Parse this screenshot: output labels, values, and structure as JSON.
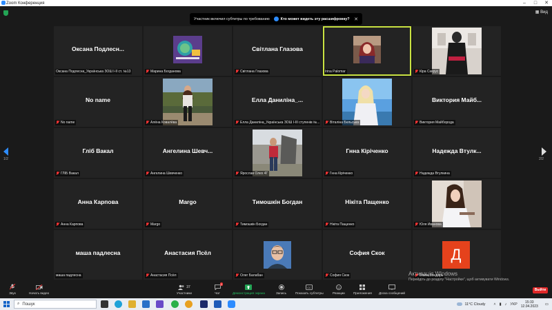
{
  "window": {
    "title": "Zoom Конференция"
  },
  "view_label": "Вид",
  "banner": {
    "text": "Участник включил субтитры по требованию",
    "link": "Кто может видеть эту расшифровку?"
  },
  "nav": {
    "left_page": "1/2",
    "right_page": "2/2"
  },
  "tiles": [
    {
      "big_name": "Оксана Подлесн...",
      "label": "Оксана Подлесна_Українська ЗОШ І-ІІ ст. №13",
      "muted": false
    },
    {
      "big_name": "",
      "label": "Марина Богданова",
      "muted": true
    },
    {
      "big_name": "Світлана Глазова",
      "label": "Світлана Глазова",
      "muted": true
    },
    {
      "big_name": "",
      "label": "Irina Palomar",
      "muted": false
    },
    {
      "big_name": "",
      "label": "Кіра Скерус",
      "muted": true
    },
    {
      "big_name": "No name",
      "label": "No name",
      "muted": true
    },
    {
      "big_name": "",
      "label": "Алёна Ковалёва",
      "muted": true
    },
    {
      "big_name": "Елла Даниліна_...",
      "label": "Елла Даниліна_Українська ЗОШ І-ІІІ ступенів №...",
      "muted": true
    },
    {
      "big_name": "",
      "label": "Віталіна Бельська",
      "muted": true
    },
    {
      "big_name": "Виктория Майб...",
      "label": "Виктория Майборода",
      "muted": true
    },
    {
      "big_name": "Гліб Вакал",
      "label": "ГЛІБ Вакал",
      "muted": true
    },
    {
      "big_name": "Ангелина Шевч...",
      "label": "Ангелина Шевченко",
      "muted": true
    },
    {
      "big_name": "",
      "label": "Ярослав Олех 4Г",
      "muted": true
    },
    {
      "big_name": "Гнна Кіріченко",
      "label": "Гнна Кіріченко",
      "muted": true
    },
    {
      "big_name": "Надежда Втулк...",
      "label": "Надежда Втулкина",
      "muted": true
    },
    {
      "big_name": "Анна Карпова",
      "label": "Анна Карпова",
      "muted": true
    },
    {
      "big_name": "Margo",
      "label": "Margo",
      "muted": true
    },
    {
      "big_name": "Тимошкін Богдан",
      "label": "Тимошкін Богдан",
      "muted": true
    },
    {
      "big_name": "Нікіта Пащенко",
      "label": "Нікіта Пащенко",
      "muted": true
    },
    {
      "big_name": "",
      "label": "Юля Иванова",
      "muted": true
    },
    {
      "big_name": "маша падлесна",
      "label": "маша падлесна",
      "muted": false
    },
    {
      "big_name": "Анастасия Псёл",
      "label": "Анастасия Псёл",
      "muted": true
    },
    {
      "big_name": "",
      "label": "Олег Балабан",
      "muted": true
    },
    {
      "big_name": "София Скок",
      "label": "София Скок",
      "muted": true
    },
    {
      "big_name": "",
      "label": "Diana Бондарь",
      "muted": true,
      "avatar_letter": "Д",
      "avatar_color": "#e5421c"
    }
  ],
  "toolbar": {
    "audio_label": "Звук",
    "video_label": "Начать видео",
    "participants_label": "Участники",
    "participants_count": "37",
    "chat_label": "Чат",
    "chat_badge": "1",
    "share_label": "Демонстрация экрана",
    "record_label": "Запись",
    "captions_label": "Показать субтитры",
    "reactions_label": "Реакции",
    "apps_label": "Приложения",
    "whiteboard_label": "Доска сообщений",
    "leave_label": "Выйти",
    "accent": "#23a455"
  },
  "watermark": {
    "title": "Активація Windows",
    "subtitle": "Перейдіть до розділу \"Настройки\", щоб активувати Windows."
  },
  "taskbar": {
    "search_placeholder": "Пошук",
    "weather": "11°C  Cloudy",
    "lang": "УКР",
    "time": "15:33",
    "date": "12.04.2023"
  }
}
